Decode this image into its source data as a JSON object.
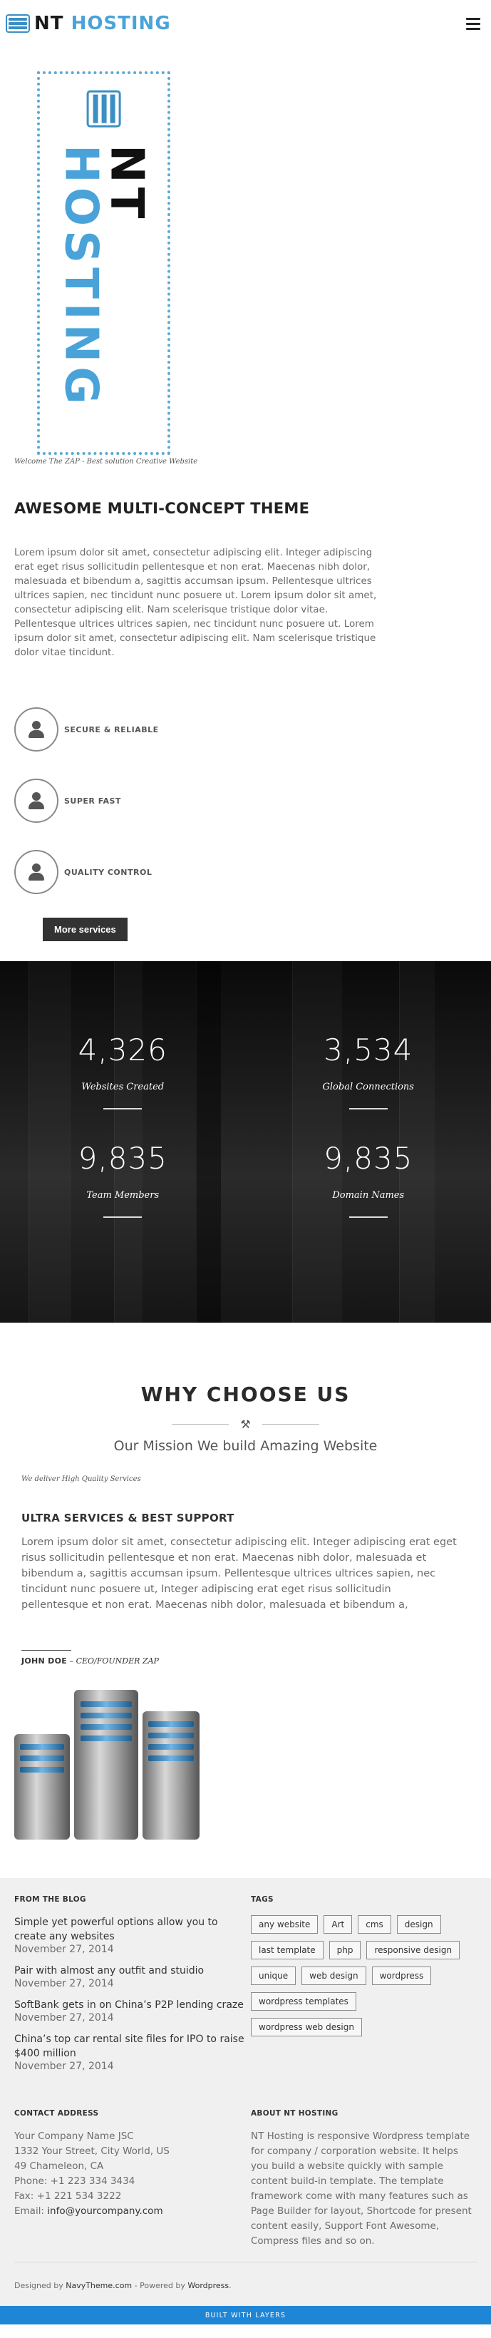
{
  "header": {
    "logo_nt": "NT",
    "logo_hosting": "HOSTING",
    "menu_icon": "hamburger-icon"
  },
  "hero": {
    "banner_nt": "NT",
    "banner_hosting": "HOSTING",
    "caption": "Welcome The ZAP - Best solution Creative Website",
    "title": "AWESOME MULTI-CONCEPT THEME",
    "intro": "Lorem ipsum dolor sit amet, consectetur adipiscing elit. Integer adipiscing erat eget risus sollicitudin pellentesque et non erat. Maecenas nibh dolor, malesuada et bibendum a, sagittis accumsan ipsum. Pellentesque ultrices ultrices sapien, nec tincidunt nunc posuere ut. Lorem ipsum dolor sit amet, consectetur adipiscing elit. Nam scelerisque tristique dolor vitae. Pellentesque ultrices ultrices sapien, nec tincidunt nunc posuere ut. Lorem ipsum dolor sit amet, consectetur adipiscing elit. Nam scelerisque tristique dolor vitae tincidunt."
  },
  "features": [
    {
      "label": "SECURE & RELIABLE",
      "icon": "user-icon"
    },
    {
      "label": "SUPER FAST",
      "icon": "user-icon"
    },
    {
      "label": "QUALITY CONTROL",
      "icon": "user-icon"
    }
  ],
  "more_button": "More services",
  "stats": [
    {
      "number": "4,326",
      "label": "Websites Created"
    },
    {
      "number": "3,534",
      "label": "Global Connections"
    },
    {
      "number": "9,835",
      "label": "Team Members"
    },
    {
      "number": "9,835",
      "label": "Domain Names"
    }
  ],
  "why": {
    "title": "WHY CHOOSE US",
    "subtitle": "Our Mission We build Amazing Website",
    "deliver": "We deliver High Quality Services",
    "ultra_title": "ULTRA SERVICES & BEST SUPPORT",
    "ultra_text": "Lorem ipsum dolor sit amet, consectetur adipiscing elit. Integer adipiscing erat eget risus sollicitudin pellentesque et non erat. Maecenas nibh dolor, malesuada et bibendum a, sagittis accumsan ipsum. Pellentesque ultrices ultrices sapien, nec tincidunt nunc posuere ut, Integer adipiscing erat eget risus sollicitudin pellentesque et non erat. Maecenas nibh dolor, malesuada et bibendum a,",
    "author_name": "JOHN DOE",
    "author_role": "CEO/FOUNDER ZAP"
  },
  "footer": {
    "blog_heading": "FROM THE BLOG",
    "blog": [
      {
        "title": "Simple yet powerful options allow you to create any websites",
        "date": "November 27, 2014"
      },
      {
        "title": "Pair with almost any outfit and stuidio",
        "date": "November 27, 2014"
      },
      {
        "title": "SoftBank gets in on China’s P2P lending craze",
        "date": "November 27, 2014"
      },
      {
        "title": "China’s top car rental site files for IPO to raise $400 million",
        "date": "November 27, 2014"
      }
    ],
    "tags_heading": "TAGS",
    "tags": [
      "any website",
      "Art",
      "cms",
      "design",
      "last template",
      "php",
      "responsive design",
      "unique",
      "web design",
      "wordpress",
      "wordpress templates",
      "wordpress web design"
    ],
    "contact_heading": "CONTACT ADDRESS",
    "contact": {
      "company": "Your Company Name JSC",
      "street": "1332 Your Street, City World, US",
      "city": "49 Chameleon, CA",
      "phone": "Phone: +1 223 334 3434",
      "fax": "Fax: +1 221 534 3222",
      "email_label": "Email: ",
      "email": "info@yourcompany.com"
    },
    "about_heading": "ABOUT NT HOSTING",
    "about_text": "NT Hosting is responsive Wordpress template for company / corporation website. It helps you build a website quickly with sample content build-in template. The template framework come with many features such as Page Builder for layout, Shortcode for present content easily, Support Font Awesome, Compress files and so on.",
    "designed_by": "Designed by ",
    "designer": "NavyTheme.com",
    "powered_by": " - Powered by ",
    "platform": "Wordpress",
    "period": ".",
    "built_with": "BUILT WITH LAYERS"
  }
}
